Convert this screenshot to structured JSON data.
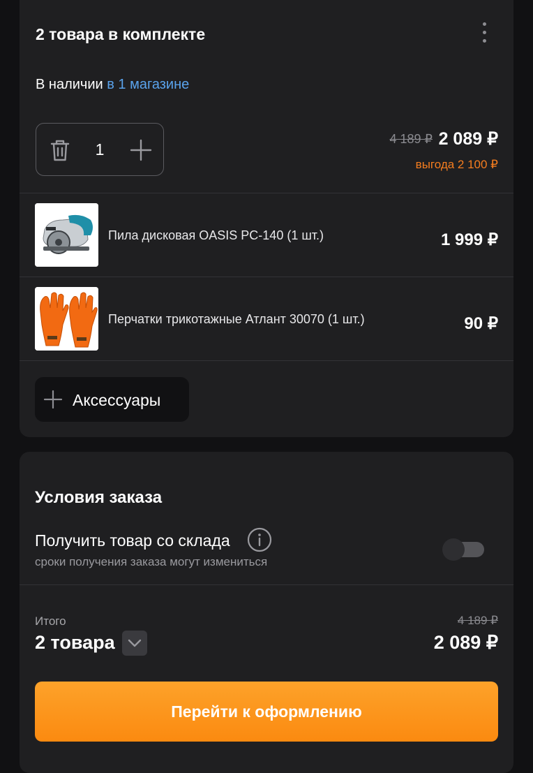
{
  "kit": {
    "title": "2 товара в комплекте",
    "availability_prefix": "В наличии",
    "availability_link": "в 1 магазине",
    "quantity": "1",
    "price_old": "4 189 ₽",
    "price_new": "2 089 ₽",
    "benefit": "выгода 2 100 ₽",
    "items": [
      {
        "name": "Пила дисковая OASIS PC-140 (1 шт.)",
        "price": "1 999 ₽",
        "image": "circular-saw-image"
      },
      {
        "name": "Перчатки трикотажные Атлант 30070 (1 шт.)",
        "price": "90 ₽",
        "image": "orange-gloves-image"
      }
    ],
    "accessories_label": "Аксессуары"
  },
  "order": {
    "title": "Условия заказа",
    "pickup_label": "Получить товар со склада",
    "pickup_sub": "сроки получения заказа могут измениться",
    "pickup_enabled": false,
    "total_label": "Итого",
    "total_count": "2 товара",
    "total_old": "4 189 ₽",
    "total_new": "2 089 ₽",
    "checkout_label": "Перейти к оформлению"
  },
  "colors": {
    "accent_orange": "#fb8a10",
    "link_blue": "#5aa3ec",
    "benefit_orange": "#f57d1f"
  },
  "icons": [
    "more-vertical-icon",
    "trash-icon",
    "plus-icon",
    "info-icon",
    "chevron-down-icon"
  ]
}
